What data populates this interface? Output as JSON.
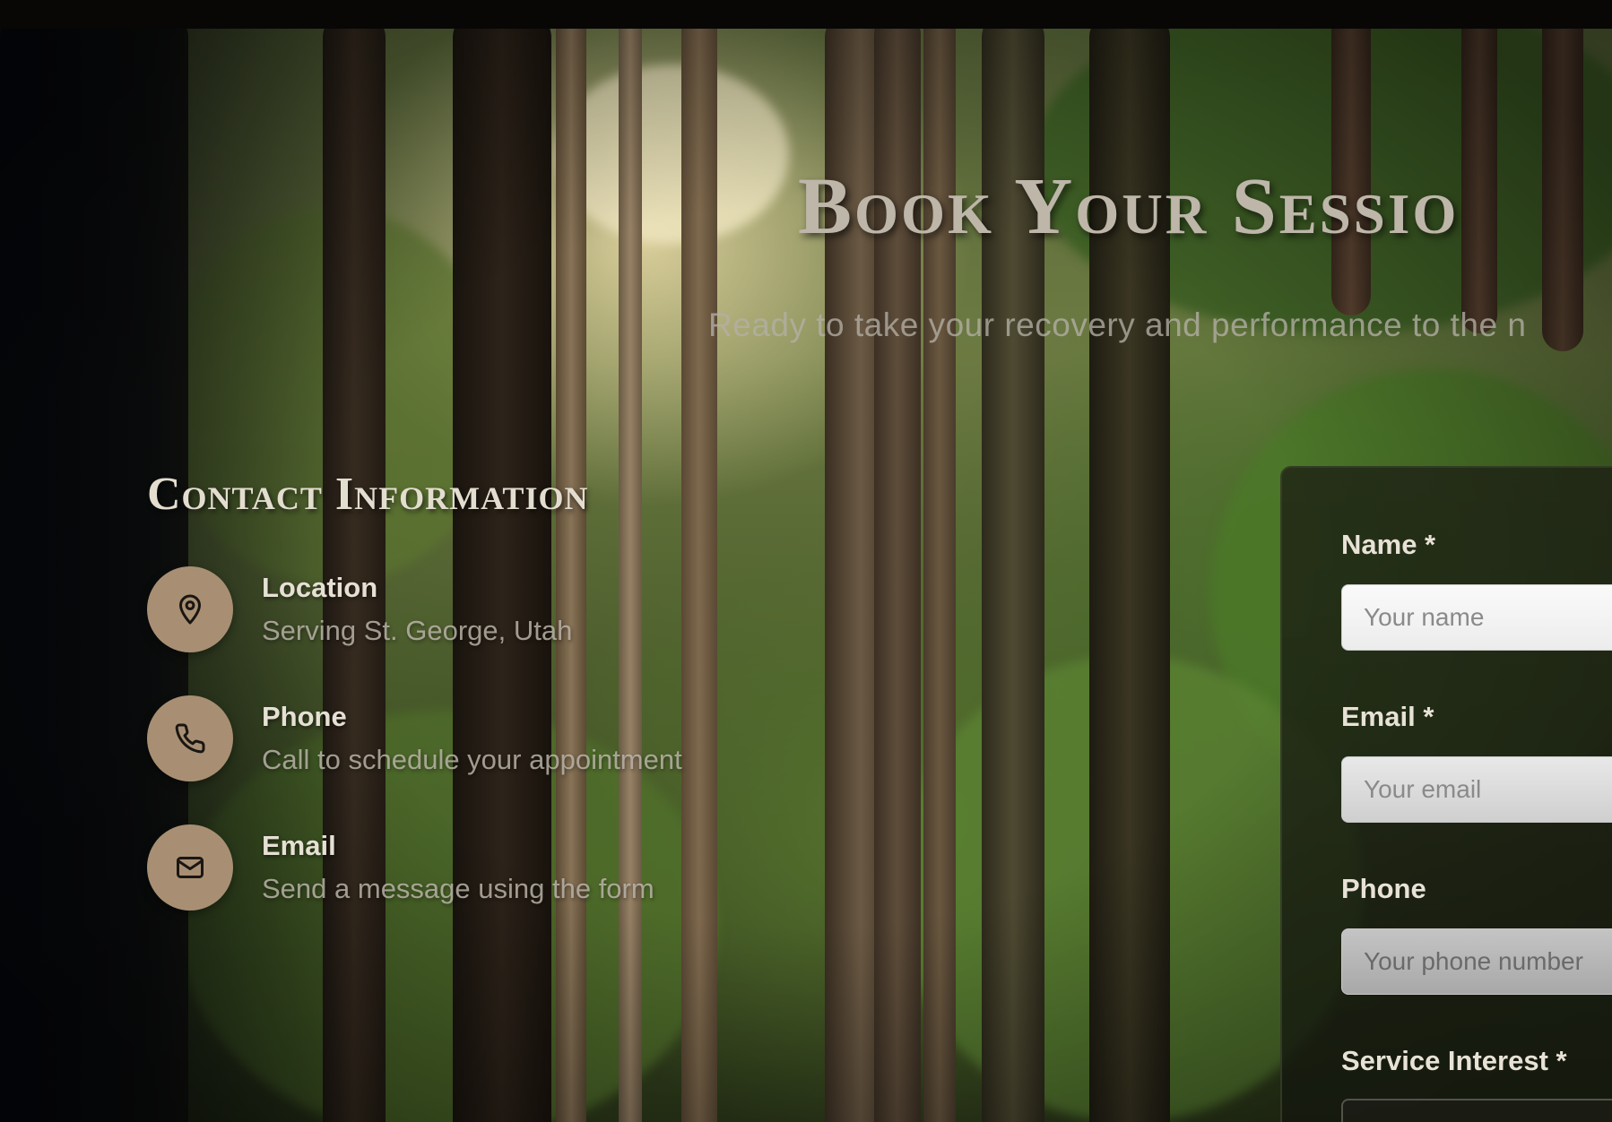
{
  "hero": {
    "title": "Book Your Sessio",
    "subtitle": "Ready to take your recovery and performance to the n"
  },
  "contact": {
    "heading": "Contact Information",
    "items": [
      {
        "icon": "location-pin-icon",
        "label": "Location",
        "value": "Serving St. George, Utah"
      },
      {
        "icon": "phone-icon",
        "label": "Phone",
        "value": "Call to schedule your appointment"
      },
      {
        "icon": "mail-icon",
        "label": "Email",
        "value": "Send a message using the form"
      }
    ]
  },
  "form": {
    "name_label": "Name *",
    "name_placeholder": "Your name",
    "email_label": "Email *",
    "email_placeholder": "Your email",
    "phone_label": "Phone",
    "phone_placeholder": "Your phone number",
    "service_label": "Service Interest *"
  },
  "colors": {
    "icon_circle": "#a88f73",
    "heading_text": "#e3ddd0",
    "hero_title": "#bdb6a9"
  }
}
